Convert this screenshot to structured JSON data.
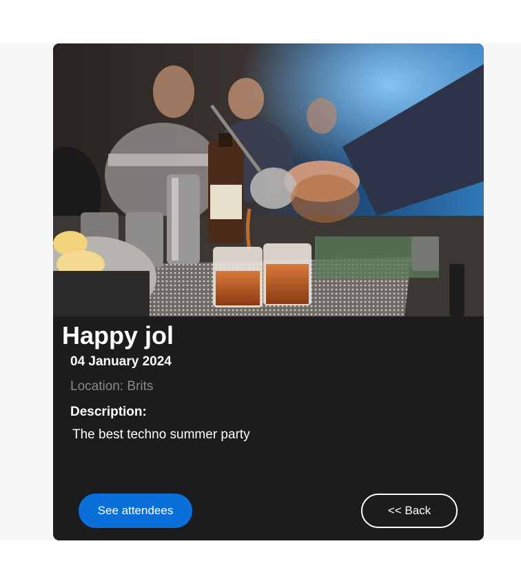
{
  "event": {
    "title": "Happy jol",
    "date": "04 January 2024",
    "location": "Location: Brits",
    "description_label": "Description:",
    "description": "The best techno summer party",
    "image_alt": "Bartender pouring cocktails at a bar"
  },
  "actions": {
    "attendees_label": "See attendees",
    "back_label": "<< Back"
  },
  "colors": {
    "card_background": "#1c1c1e",
    "primary_button": "#0a6fd8",
    "muted_text": "#8a8a8e"
  }
}
